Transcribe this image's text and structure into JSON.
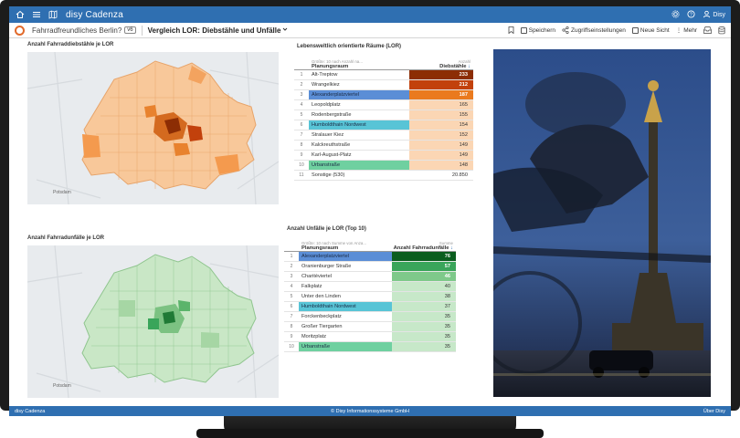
{
  "topbar": {
    "brand": "disy Cadenza",
    "user": "Disy",
    "icons": [
      "home-icon",
      "menu-icon",
      "map-icon",
      "settings-icon",
      "help-icon",
      "user-icon"
    ]
  },
  "subbar": {
    "project": "Fahrradfreundliches Berlin?",
    "version": "v6",
    "view_title": "Vergleich LOR: Diebstähle und Unfälle",
    "tools": {
      "save": "Speichern",
      "access": "Zugriffseinstellungen",
      "new_view": "Neue Sicht",
      "more": "Mehr"
    }
  },
  "map1": {
    "title": "Anzahl Fahrraddiebstähle je LOR",
    "label_potsdam": "Potsdam"
  },
  "map2": {
    "title": "Anzahl Fahrradunfälle je LOR",
    "label_potsdam": "Potsdam"
  },
  "table1": {
    "title": "Lebensweltlich orientierte Räume (LOR)",
    "col1_sub": "Größte: 10 nach Anzahl na...",
    "col1": "Planungsraum",
    "col2_sub": "Anzahl",
    "col2": "Diebstähle",
    "rows": [
      {
        "n": "1",
        "name": "Alt-Treptow",
        "value": "233",
        "bg": "#8c2d04",
        "fg": "#ffffff",
        "name_bg": ""
      },
      {
        "n": "2",
        "name": "Wrangelkiez",
        "value": "212",
        "bg": "#c2410c",
        "fg": "#ffffff",
        "name_bg": ""
      },
      {
        "n": "3",
        "name": "Alexanderplatzviertel",
        "value": "187",
        "bg": "#ea7a1e",
        "fg": "#ffffff",
        "name_bg": "#5b8ed6"
      },
      {
        "n": "4",
        "name": "Leopoldplatz",
        "value": "165",
        "bg": "#fbd6b4",
        "fg": "#333333",
        "name_bg": ""
      },
      {
        "n": "5",
        "name": "Rodenbergstraße",
        "value": "155",
        "bg": "#fbd6b4",
        "fg": "#333333",
        "name_bg": ""
      },
      {
        "n": "6",
        "name": "Humboldthain Nordwest",
        "value": "154",
        "bg": "#fbd6b4",
        "fg": "#333333",
        "name_bg": "#58c4d6"
      },
      {
        "n": "7",
        "name": "Stralauer Kiez",
        "value": "152",
        "bg": "#fbd6b4",
        "fg": "#333333",
        "name_bg": ""
      },
      {
        "n": "8",
        "name": "Kalckreuthstraße",
        "value": "149",
        "bg": "#fbd6b4",
        "fg": "#333333",
        "name_bg": ""
      },
      {
        "n": "9",
        "name": "Karl-August-Platz",
        "value": "149",
        "bg": "#fbd6b4",
        "fg": "#333333",
        "name_bg": ""
      },
      {
        "n": "10",
        "name": "Urbanstraße",
        "value": "148",
        "bg": "#fbd6b4",
        "fg": "#333333",
        "name_bg": "#6fd0a0"
      },
      {
        "n": "11",
        "name": "Sonstige (530)",
        "value": "20.850",
        "bg": "#ffffff",
        "fg": "#333333",
        "name_bg": ""
      }
    ]
  },
  "table2": {
    "title": "Anzahl Unfälle je LOR (Top 10)",
    "col1_sub": "Größte: 10 nach Summe von Anza...",
    "col1": "Planungsraum",
    "col2_sub": "Summe",
    "col2": "Anzahl Fahrradunfälle",
    "rows": [
      {
        "n": "1",
        "name": "Alexanderplatzviertel",
        "value": "76",
        "bg": "#0b5d1e",
        "fg": "#ffffff",
        "name_bg": "#5b8ed6"
      },
      {
        "n": "2",
        "name": "Oranienburger Straße",
        "value": "57",
        "bg": "#3aa55a",
        "fg": "#ffffff",
        "name_bg": ""
      },
      {
        "n": "3",
        "name": "Charitéviertel",
        "value": "46",
        "bg": "#7ec98a",
        "fg": "#ffffff",
        "name_bg": ""
      },
      {
        "n": "4",
        "name": "Falkplatz",
        "value": "40",
        "bg": "#c7e8c9",
        "fg": "#333333",
        "name_bg": ""
      },
      {
        "n": "5",
        "name": "Unter den Linden",
        "value": "38",
        "bg": "#c7e8c9",
        "fg": "#333333",
        "name_bg": ""
      },
      {
        "n": "6",
        "name": "Humboldthain Nordwest",
        "value": "37",
        "bg": "#c7e8c9",
        "fg": "#333333",
        "name_bg": "#58c4d6"
      },
      {
        "n": "7",
        "name": "Forckenbeckplatz",
        "value": "35",
        "bg": "#c7e8c9",
        "fg": "#333333",
        "name_bg": ""
      },
      {
        "n": "8",
        "name": "Großer Tiergarten",
        "value": "35",
        "bg": "#c7e8c9",
        "fg": "#333333",
        "name_bg": ""
      },
      {
        "n": "9",
        "name": "Moritzplatz",
        "value": "35",
        "bg": "#c7e8c9",
        "fg": "#333333",
        "name_bg": ""
      },
      {
        "n": "10",
        "name": "Urbanstraße",
        "value": "35",
        "bg": "#c7e8c9",
        "fg": "#333333",
        "name_bg": "#6fd0a0"
      }
    ]
  },
  "footer": {
    "left": "disy Cadenza",
    "center": "© Disy Informationssysteme GmbH",
    "right": "Über Disy"
  },
  "colors": {
    "accent": "#2f6fb1",
    "map1_fill": "#f5b27a",
    "map1_dark": "#c2410c",
    "map2_fill": "#a8d8a8",
    "map2_dark": "#2e8b3c"
  }
}
